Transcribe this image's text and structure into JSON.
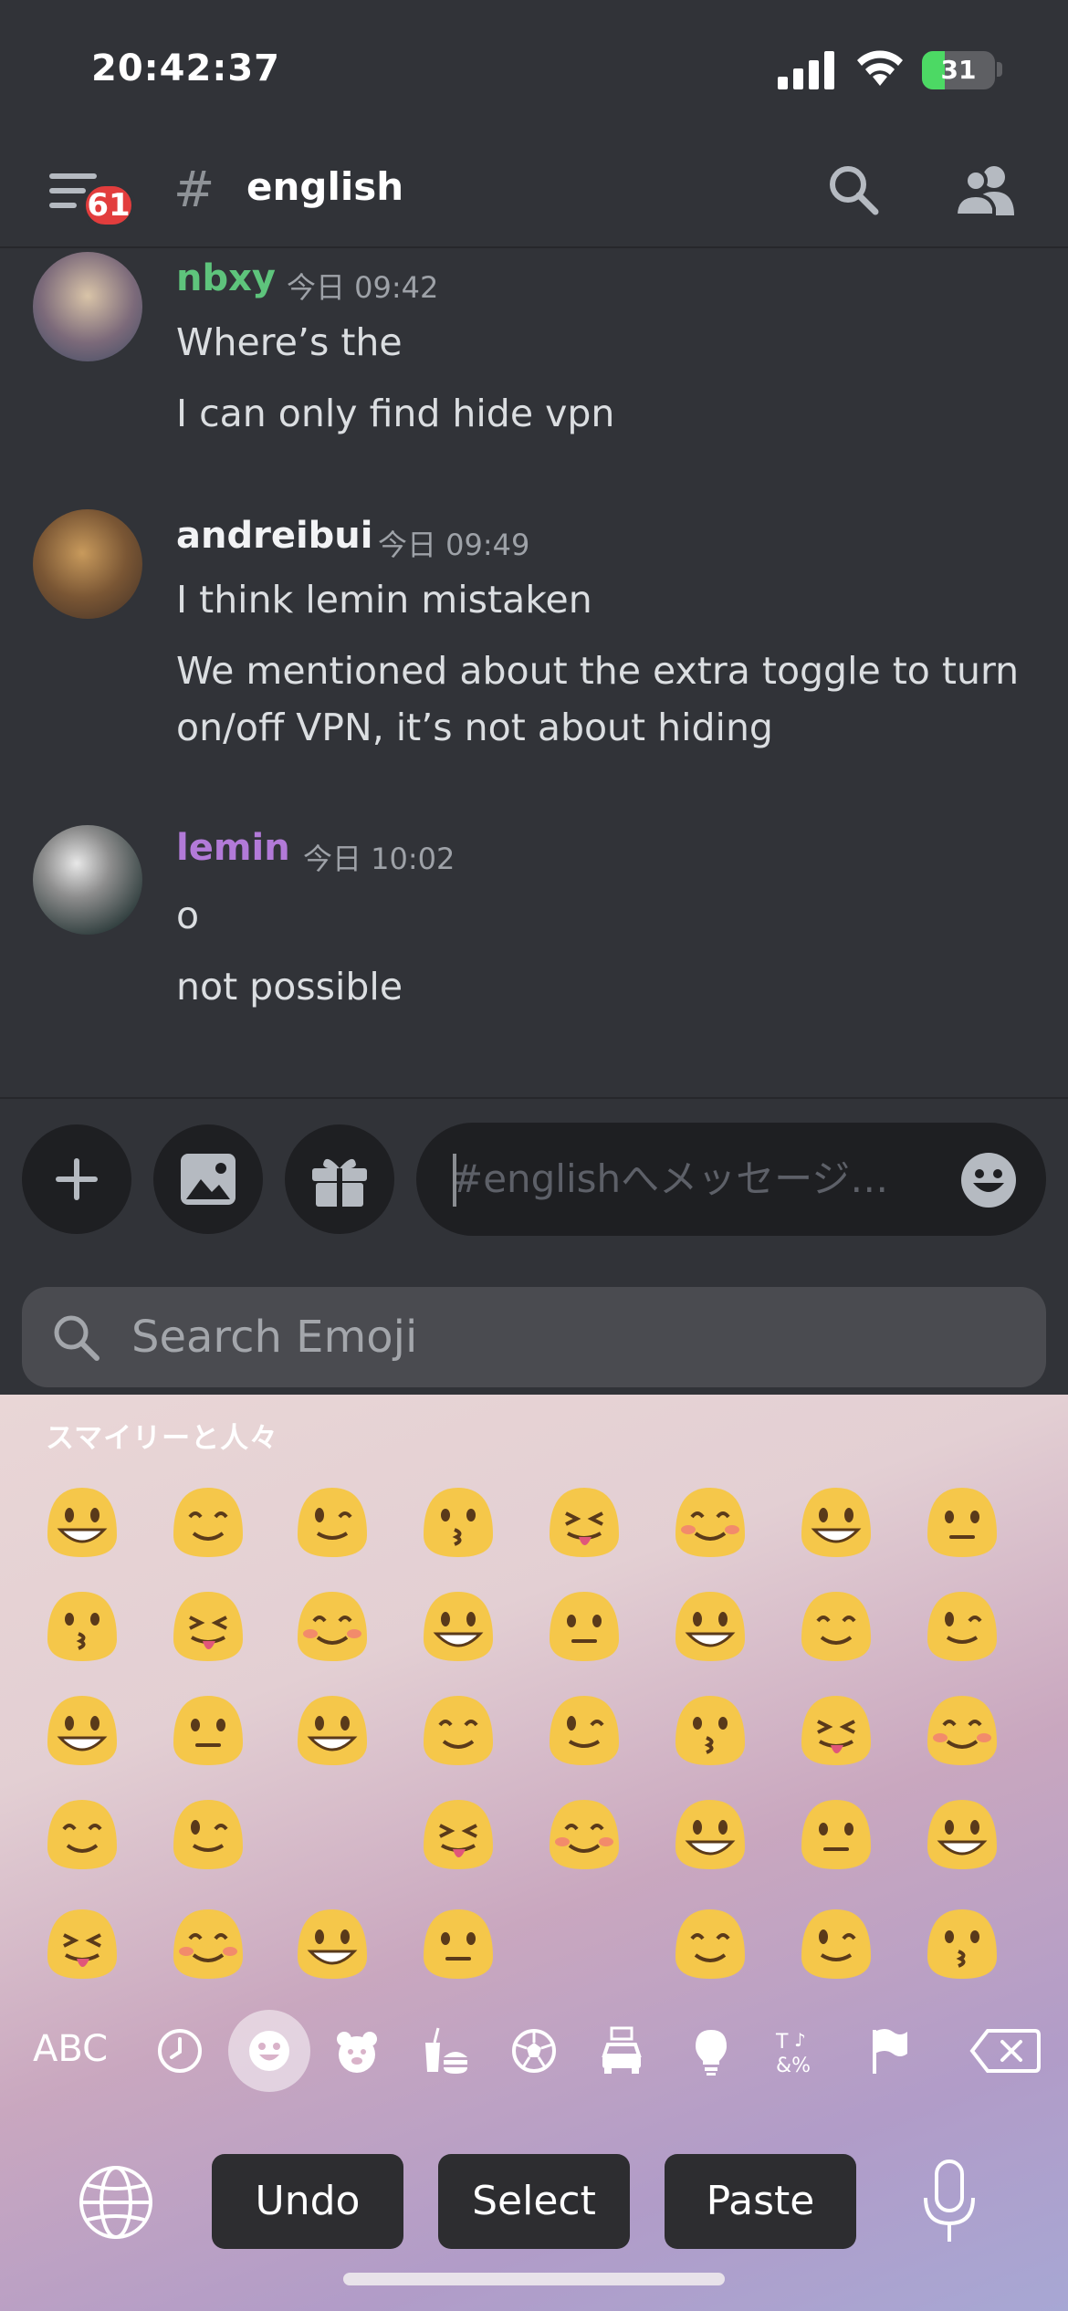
{
  "status": {
    "time": "20:42:37",
    "battery": "31",
    "battery_level_pct": 31
  },
  "header": {
    "unread_badge": "61",
    "hash": "#",
    "channel": "english"
  },
  "messages": [
    {
      "user": "nbxy",
      "color": "#5ec47c",
      "timestamp": "今日 09:42",
      "lines": [
        "Where’s the",
        "I can only find hide vpn"
      ]
    },
    {
      "user": "andreibui",
      "color": "#f2f3f5",
      "timestamp": "今日 09:49",
      "lines": [
        "I think lemin mistaken",
        "We mentioned about the extra toggle to turn",
        "on/off VPN, it’s not about hiding"
      ]
    },
    {
      "user": "lemin",
      "color": "#b27ad8",
      "timestamp": "今日 10:02",
      "lines": [
        "o",
        "not possible"
      ]
    }
  ],
  "composer": {
    "placeholder": "#englishへメッセージ…"
  },
  "emoji_search": {
    "placeholder": "Search Emoji"
  },
  "keyboard": {
    "category": "スマイリーと人々",
    "abc": "ABC",
    "tabs": [
      "recent-icon",
      "smileys-icon",
      "animals-icon",
      "food-icon",
      "activity-icon",
      "travel-icon",
      "objects-icon",
      "symbols-icon",
      "flags-icon"
    ],
    "undo": "Undo",
    "select": "Select",
    "paste": "Paste"
  },
  "colors": {
    "bg": "#313338",
    "header_text": "#ffffff",
    "badge": "#e23d3d",
    "emoji_face": "#f5c74a"
  }
}
